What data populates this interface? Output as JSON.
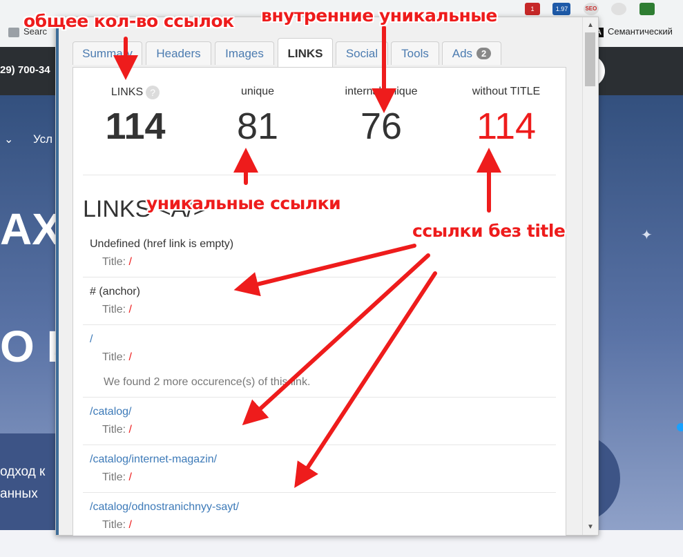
{
  "browser": {
    "bookmark_left": "Searc",
    "bookmark_right": "Семантический",
    "bookmark_right_icon": "A",
    "ext_badge_1": "1",
    "ext_badge_2": "1.97",
    "ext_badge_seo": "SEO"
  },
  "site": {
    "phone": "29) 700-34",
    "nav_item": "Усл",
    "hero_line1": "АХ",
    "hero_line2": "О И",
    "hero_text_1": "одход к",
    "hero_text_2": "анных"
  },
  "popup": {
    "tabs": [
      {
        "label": "Summary"
      },
      {
        "label": "Headers"
      },
      {
        "label": "Images"
      },
      {
        "label": "LINKS"
      },
      {
        "label": "Social"
      },
      {
        "label": "Tools"
      },
      {
        "label": "Ads",
        "badge": "2"
      }
    ],
    "stats": [
      {
        "label": "LINKS",
        "value": "114"
      },
      {
        "label": "unique",
        "value": "81"
      },
      {
        "label": "internal unique",
        "value": "76"
      },
      {
        "label": "without TITLE",
        "value": "114"
      }
    ],
    "section_title": "LINKS <A/>",
    "title_prefix": "Title:",
    "links": [
      {
        "href": "Undefined (href link is empty)",
        "title": "/"
      },
      {
        "href": "# (anchor)",
        "title": "/"
      },
      {
        "href": "/",
        "title": "/",
        "more": "We found 2 more occurence(s) of this link."
      },
      {
        "href": "/catalog/",
        "title": "/"
      },
      {
        "href": "/catalog/internet-magazin/",
        "title": "/"
      },
      {
        "href": "/catalog/odnostranichnyy-sayt/",
        "title": "/"
      }
    ]
  },
  "annotations": {
    "total_links": "общее кол-во ссылок",
    "internal_unique": "внутренние уникальные",
    "unique_links": "уникальные ссылки",
    "links_without_title": "ссылки без title"
  },
  "colors": {
    "accent_red": "#ee1c1c",
    "link_blue": "#3d7ab8",
    "tab_blue": "#4b7bb0"
  }
}
